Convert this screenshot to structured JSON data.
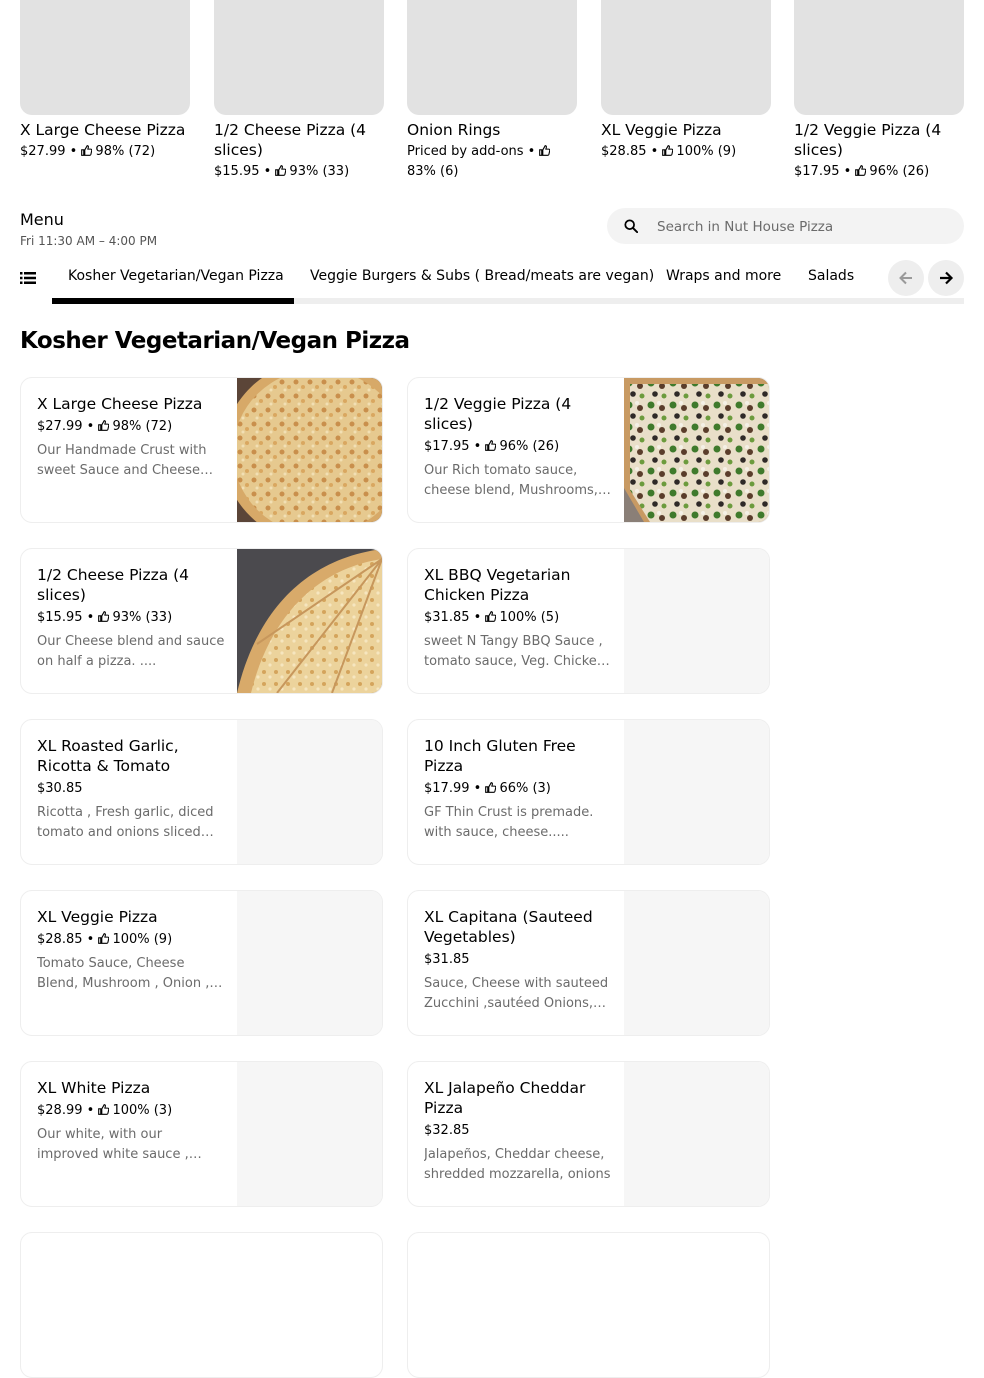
{
  "featured": [
    {
      "name": "X Large Cheese Pizza",
      "meta": "$27.99 • ",
      "rating": "98% (72)"
    },
    {
      "name": "1/2 Cheese Pizza (4 slices)",
      "meta": "$15.95 • ",
      "rating": "93% (33)"
    },
    {
      "name": "Onion Rings",
      "meta": "Priced by add-ons • ",
      "rating": "83% (6)"
    },
    {
      "name": "XL Veggie Pizza",
      "meta": "$28.85 • ",
      "rating": "100% (9)"
    },
    {
      "name": "1/2  Veggie Pizza (4 slices)",
      "meta": "$17.95 • ",
      "rating": "96% (26)"
    }
  ],
  "menu": {
    "title": "Menu",
    "hours": "Fri 11:30 AM – 4:00 PM"
  },
  "search": {
    "placeholder": "Search in Nut House Pizza",
    "value": ""
  },
  "tabs": [
    {
      "label": "Kosher Vegetarian/Vegan Pizza",
      "active": true
    },
    {
      "label": "Veggie Burgers & Subs ( Bread/meats are vegan)",
      "active": false
    },
    {
      "label": "Wraps and more",
      "active": false
    },
    {
      "label": "Salads",
      "active": false
    }
  ],
  "section": {
    "title": "Kosher Vegetarian/Vegan Pizza"
  },
  "items": [
    {
      "name": "X Large Cheese Pizza",
      "price": "$27.99",
      "rating": "98% (72)",
      "desc": "Our Handmade Crust with sweet Sauce and Cheese blend.",
      "image": "cheese-pizza"
    },
    {
      "name": "1/2  Veggie Pizza (4 slices)",
      "price": "$17.95",
      "rating": "96% (26)",
      "desc": "Our Rich tomato sauce, cheese blend, Mushrooms, onions, peppers and olives.",
      "image": "veggie-pizza"
    },
    {
      "name": "1/2 Cheese Pizza (4 slices)",
      "price": "$15.95",
      "rating": "93% (33)",
      "desc": "Our Cheese blend and sauce on half a pizza. ....",
      "image": "cheese-slices"
    },
    {
      "name": "XL BBQ  Vegetarian Chicken Pizza",
      "price": "$31.85",
      "rating": "100% (5)",
      "desc": "sweet N Tangy BBQ Sauce , tomato sauce, Veg. Chicken, cheese blend",
      "image": ""
    },
    {
      "name": "XL Roasted Garlic, Ricotta & Tomato",
      "price": "$30.85",
      "rating": "",
      "desc": "Ricotta , Fresh garlic, diced tomato and onions sliced thin",
      "image": ""
    },
    {
      "name": "10 Inch Gluten Free Pizza",
      "price": "$17.99",
      "rating": "66% (3)",
      "desc": "GF Thin Crust is premade. with sauce, cheese.....",
      "image": ""
    },
    {
      "name": "XL Veggie Pizza",
      "price": "$28.85",
      "rating": "100% (9)",
      "desc": "Tomato Sauce, Cheese Blend, Mushroom , Onion , Peppers",
      "image": ""
    },
    {
      "name": "XL Capitana (Sauteed Vegetables)",
      "price": "$31.85",
      "rating": "",
      "desc": "Sauce, Cheese with sauteed Zucchini ,sautéed Onions, peppers",
      "image": ""
    },
    {
      "name": "XL White Pizza",
      "price": "$28.99",
      "rating": "100% (3)",
      "desc": "Our white, with our improved white sauce , oregano and garlic",
      "image": ""
    },
    {
      "name": "XL Jalapeño Cheddar Pizza",
      "price": "$32.85",
      "rating": "",
      "desc": "Jalapeños, Cheddar cheese, shredded mozzarella, onions",
      "image": ""
    }
  ],
  "icons": {
    "thumb": "thumbs-up-icon",
    "search": "search-icon",
    "list": "list-icon",
    "prev": "arrow-left-icon",
    "next": "arrow-right-icon"
  }
}
